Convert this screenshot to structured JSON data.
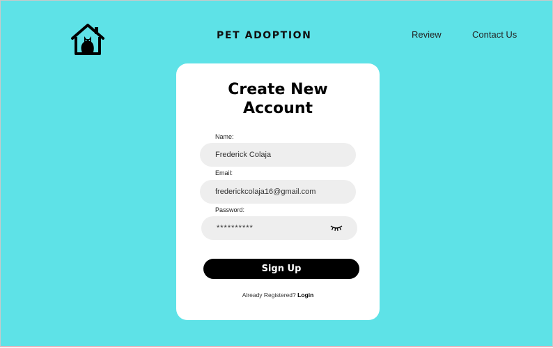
{
  "header": {
    "logo_icon": "house-cat-icon",
    "brand": "PET ADOPTION",
    "nav": {
      "review": "Review",
      "contact": "Contact Us"
    }
  },
  "form": {
    "title_line1": "Create New",
    "title_line2": "Account",
    "name_label": "Name:",
    "name_value": "Frederick Colaja",
    "email_label": "Email:",
    "email_value": "frederickcolaja16@gmail.com",
    "password_label": "Password:",
    "password_value": "**********",
    "password_toggle_icon": "eye-closed-icon",
    "submit_label": "Sign Up",
    "already_text": "Already Registered?",
    "login_label": "Login"
  },
  "colors": {
    "background": "#5ee2e7",
    "card": "#ffffff",
    "input": "#eeeeee",
    "button": "#000000"
  }
}
